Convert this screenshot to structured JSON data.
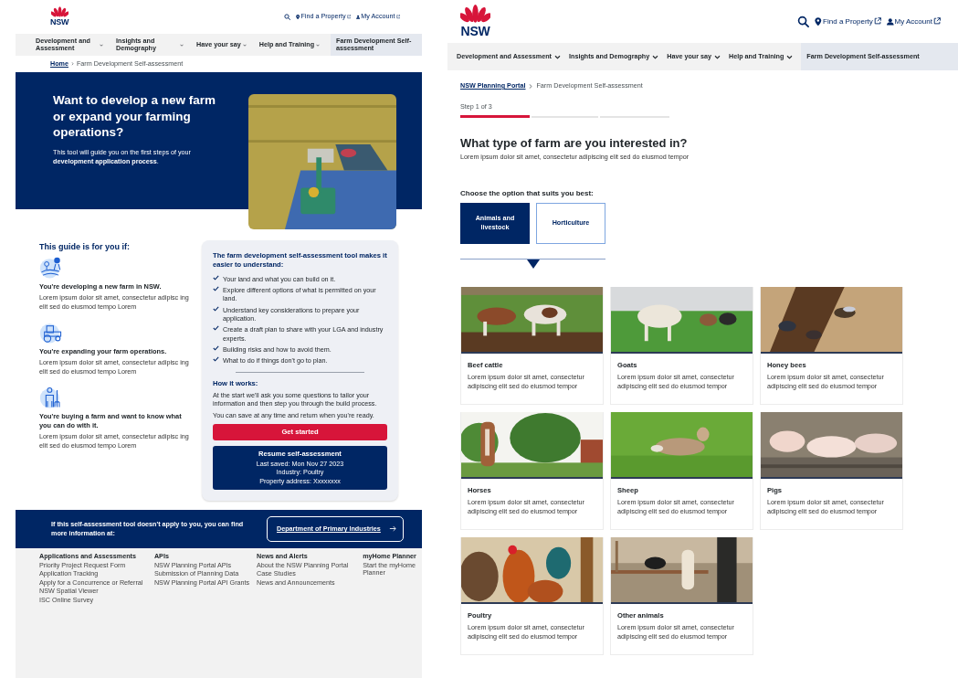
{
  "overview_page": {
    "header": {
      "logo_text": "NSW",
      "links": [
        "Find a Property",
        "My Account"
      ]
    },
    "nav": [
      {
        "label": "Development and Assessment",
        "dropdown": true,
        "selected": false
      },
      {
        "label": "Insights and Demography",
        "dropdown": true,
        "selected": false
      },
      {
        "label": "Have your say",
        "dropdown": true,
        "selected": false
      },
      {
        "label": "Help and Training",
        "dropdown": true,
        "selected": false
      },
      {
        "label": "Farm Development Self-assessment",
        "dropdown": false,
        "selected": true
      }
    ],
    "breadcrumb": [
      {
        "label": "Home",
        "link": true
      },
      {
        "label": "Farm Development Self-assessment",
        "link": false
      }
    ],
    "hero": {
      "title": "Want to develop a new farm or expand your farming operations?",
      "text": "This tool will guide you on the first steps of your **development application process**."
    },
    "guide": {
      "title": "This guide is for you if:",
      "items": [
        {
          "title": "You're developing a new farm in NSW.",
          "text": "Lorem ipsum dolor sit amet, consectetur adipisc ing elit sed do eiusmod tempo Lorem"
        },
        {
          "title": "You're expanding your farm operations.",
          "text": "Lorem ipsum dolor sit amet, consectetur adipisc ing elit sed do eiusmod tempo Lorem"
        },
        {
          "title": "You're buying a farm and want to know what you can do with it.",
          "text": "Lorem ipsum dolor sit amet, consectetur adipisc ing elit sed do eiusmod tempo Lorem"
        }
      ]
    },
    "tool_card": {
      "title": "The farm development self-assessment tool makes it easier to understand:",
      "checks": [
        "Your land and what you can build on it.",
        "Explore different options of what is permitted on your land.",
        "Understand key considerations to prepare your application.",
        "Create a draft plan to share with your LGA and industry experts.",
        "Building risks and how to avoid them.",
        "What to do if things don't go to plan."
      ],
      "how_title": "How it works:",
      "how_paragraphs": [
        "At the start we'll ask you some questions to tailor your information and then step you through the build process.",
        "You can save at any time and return when you're ready."
      ],
      "start_button": "Get started",
      "resume": {
        "title": "Resume self-assessment",
        "details": [
          "Last saved: Mon Nov 27 2023",
          "Industry: Poultry",
          "Property address: Xxxxxxxx"
        ]
      }
    },
    "banner": {
      "text": "If this self-assessment tool doesn't apply to you, you can find more information at:",
      "link": "Department of Primary Industries"
    },
    "footer": {
      "columns": [
        {
          "title": "Applications and Assessments",
          "links": [
            "Priority Project Request Form",
            "Application Tracking",
            "Apply for a Concurrence or Referral",
            "NSW Spatial Viewer",
            "ISC Online Survey"
          ]
        },
        {
          "title": "APIs",
          "links": [
            "NSW Planning Portal APIs",
            "Submission of Planning Data",
            "NSW Planning Portal API Grants"
          ]
        },
        {
          "title": "News and Alerts",
          "links": [
            "About the NSW Planning Portal",
            "Case Studies",
            "News and Announcements"
          ]
        },
        {
          "title": "myHome Planner",
          "links": [
            "Start the myHome Planner"
          ]
        }
      ]
    }
  },
  "step_page": {
    "header": {
      "logo_text": "NSW",
      "links": [
        "Find a Property",
        "My Account"
      ]
    },
    "nav": [
      {
        "label": "Development and Assessment",
        "dropdown": true,
        "selected": false
      },
      {
        "label": "Insights and Demography",
        "dropdown": true,
        "selected": false
      },
      {
        "label": "Have your say",
        "dropdown": true,
        "selected": false
      },
      {
        "label": "Help and Training",
        "dropdown": true,
        "selected": false
      },
      {
        "label": "Farm Development Self-assessment",
        "dropdown": false,
        "selected": true
      }
    ],
    "breadcrumb": [
      {
        "label": "NSW Planning Portal",
        "link": true
      },
      {
        "label": "Farm Development Self-assessment",
        "link": false
      }
    ],
    "progress": {
      "label": "Step 1 of 3",
      "level": 0.333
    },
    "title": "What type of farm are you interested in?",
    "subtitle": "Lorem ipsum dolor sit amet, consectetur adipiscing elit sed do eiusmod tempor",
    "prompt": "Choose the option that suits you best:",
    "options": [
      {
        "label": "Animals and livestock",
        "selected": true
      },
      {
        "label": "Horticulture",
        "selected": false
      }
    ],
    "cards": [
      {
        "title": "Beef cattle",
        "text": "Lorem ipsum dolor sit amet, consectetur adipiscing elit sed do eiusmod tempor"
      },
      {
        "title": "Goats",
        "text": "Lorem ipsum dolor sit amet, consectetur adipiscing elit sed do eiusmod tempor"
      },
      {
        "title": "Honey bees",
        "text": "Lorem ipsum dolor sit amet, consectetur adipiscing elit sed do eiusmod tempor"
      },
      {
        "title": "Horses",
        "text": "Lorem ipsum dolor sit amet, consectetur adipiscing elit sed do eiusmod tempor"
      },
      {
        "title": "Sheep",
        "text": "Lorem ipsum dolor sit amet, consectetur adipiscing elit sed do eiusmod tempor"
      },
      {
        "title": "Pigs",
        "text": "Lorem ipsum dolor sit amet, consectetur adipiscing elit sed do eiusmod tempor"
      },
      {
        "title": "Poultry",
        "text": "Lorem ipsum dolor sit amet, consectetur adipiscing elit sed do eiusmod tempor"
      },
      {
        "title": "Other animals",
        "text": "Lorem ipsum dolor sit amet, consectetur adipiscing elit sed do eiusmod tempor"
      }
    ]
  }
}
